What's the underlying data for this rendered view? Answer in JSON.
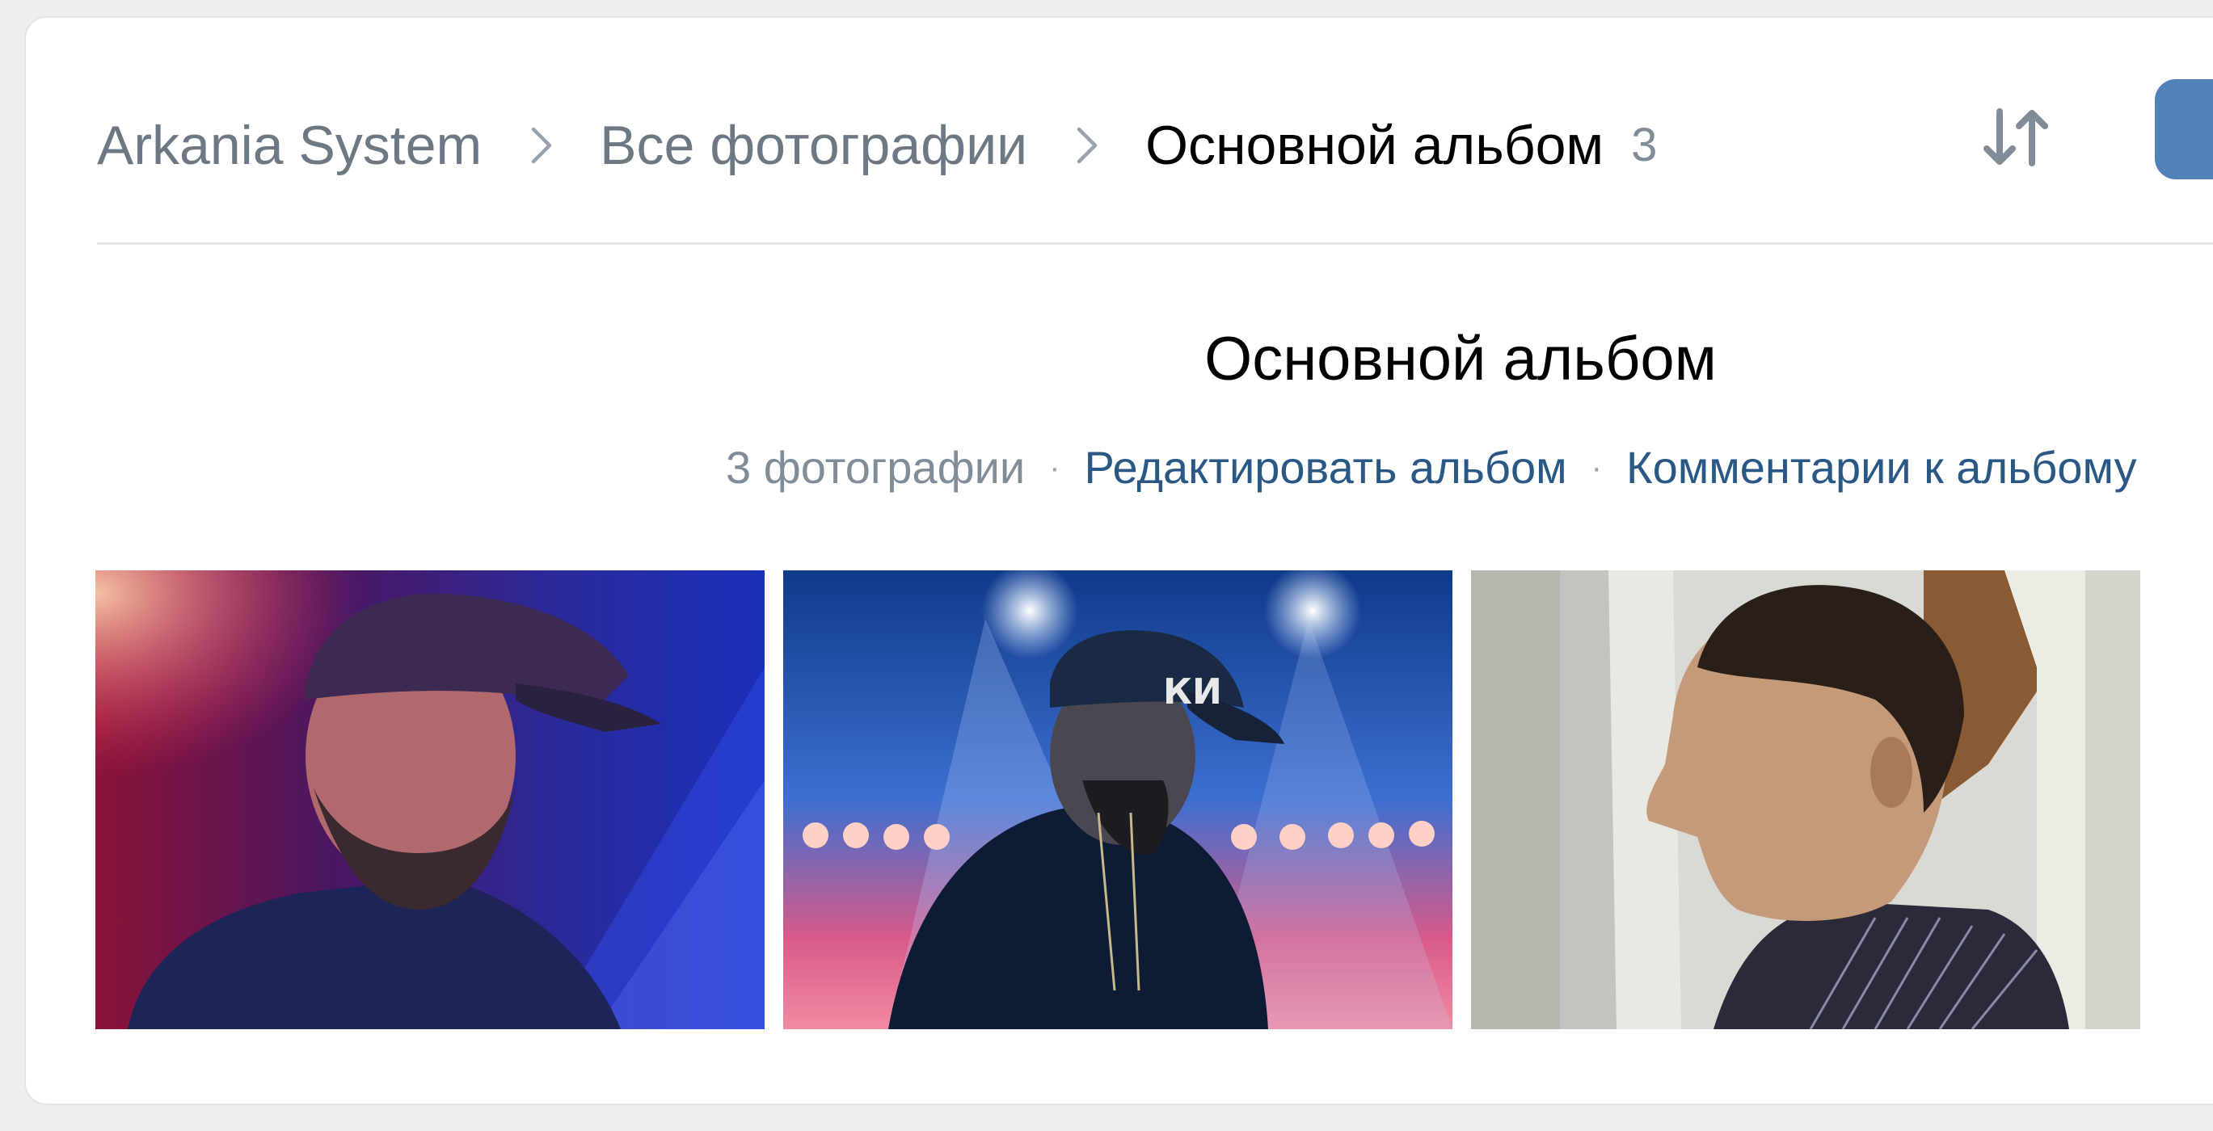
{
  "breadcrumb": {
    "items": [
      {
        "label": "Arkania System"
      },
      {
        "label": "Все фотографии"
      }
    ],
    "current": "Основной альбом",
    "count": "3"
  },
  "icons": {
    "sort": "sort-arrows-icon",
    "chevron": "chevron-right-icon"
  },
  "album": {
    "title": "Основной альбом",
    "photo_count": "3 фотографии",
    "separator": "·",
    "edit_link": "Редактировать альбом",
    "comments_link": "Комментарии к альбому"
  },
  "photos": [
    {
      "name": "photo-1"
    },
    {
      "name": "photo-2"
    },
    {
      "name": "photo-3"
    }
  ],
  "colors": {
    "accent": "#5181b8",
    "link": "#2a5885",
    "muted": "#6d7885",
    "background": "#edeef0"
  }
}
